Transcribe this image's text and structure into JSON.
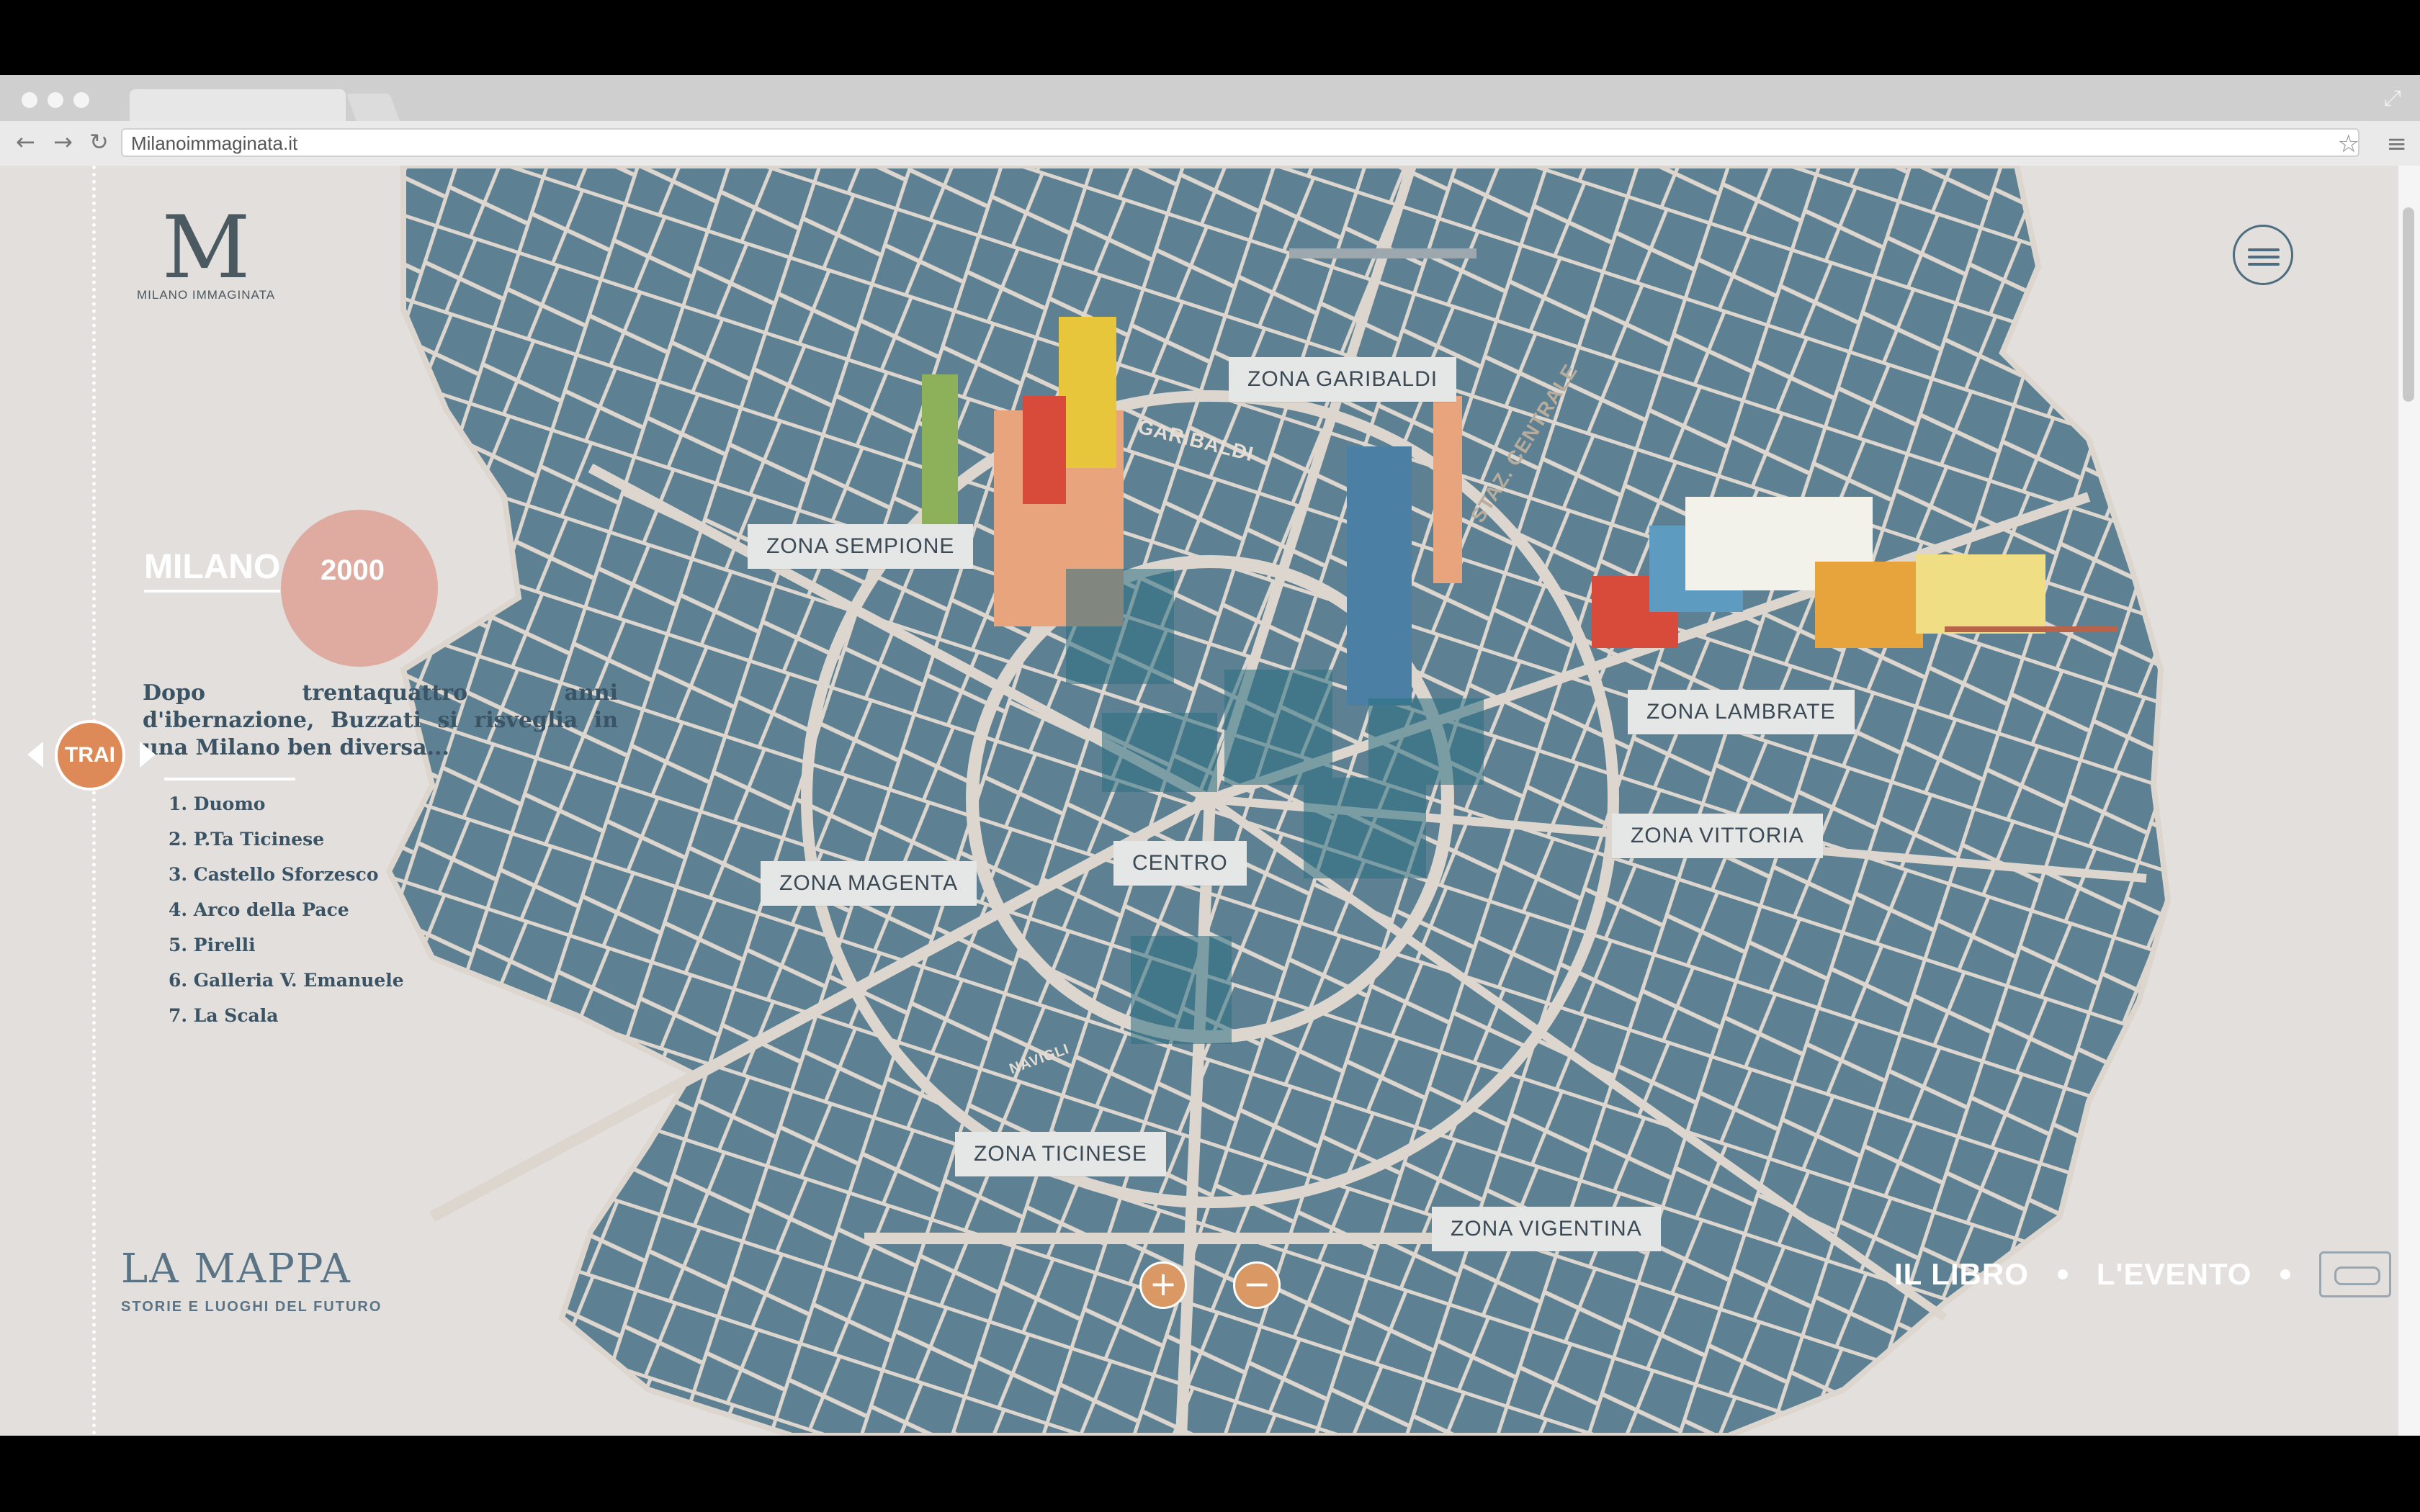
{
  "browser": {
    "url": "Milanoimmaginata.it",
    "back_icon": "←",
    "forward_icon": "→",
    "reload_icon": "↻",
    "star_icon": "☆",
    "menu_icon": "≡",
    "expand_icon": "⤢"
  },
  "logo": {
    "mark": "M",
    "name": "MILANO IMMAGINATA"
  },
  "era": {
    "city": "MILANO",
    "year": "2000"
  },
  "intro": "Dopo trentaquattro anni d'ibernazione, Buzzati si risveglia in una Milano ben diversa...",
  "places": [
    "1. Duomo",
    "2. P.Ta Ticinese",
    "3. Castello Sforzesco",
    "4. Arco della Pace",
    "5. Pirelli",
    "6. Galleria V. Emanuele",
    "7. La Scala"
  ],
  "timeline_knob": "TRAI",
  "zones": {
    "garibaldi": "ZONA GARIBALDI",
    "sempione": "ZONA SEMPIONE",
    "lambrate": "ZONA LAMBRATE",
    "vittoria": "ZONA VITTORIA",
    "centro": "CENTRO",
    "magenta": "ZONA MAGENTA",
    "ticinese": "ZONA TICINESE",
    "vigentina": "ZONA VIGENTINA"
  },
  "street_labels": {
    "garibaldi": "GARIBALDI",
    "staz_centrale": "STAZ. CENTRALE",
    "navigli": "NAVIGLI"
  },
  "mappa": {
    "title": "LA MAPPA",
    "subtitle": "STORIE E LUOGHI DEL FUTURO"
  },
  "zoom": {
    "in": "+",
    "out": "−"
  },
  "footer_nav": {
    "libro": "IL LIBRO",
    "evento": "L'EVENTO"
  },
  "colors": {
    "map_water": "#5d8193",
    "roads": "#ddd6cf",
    "background": "#e3dfdc",
    "accent_orange": "#dd8a58"
  }
}
